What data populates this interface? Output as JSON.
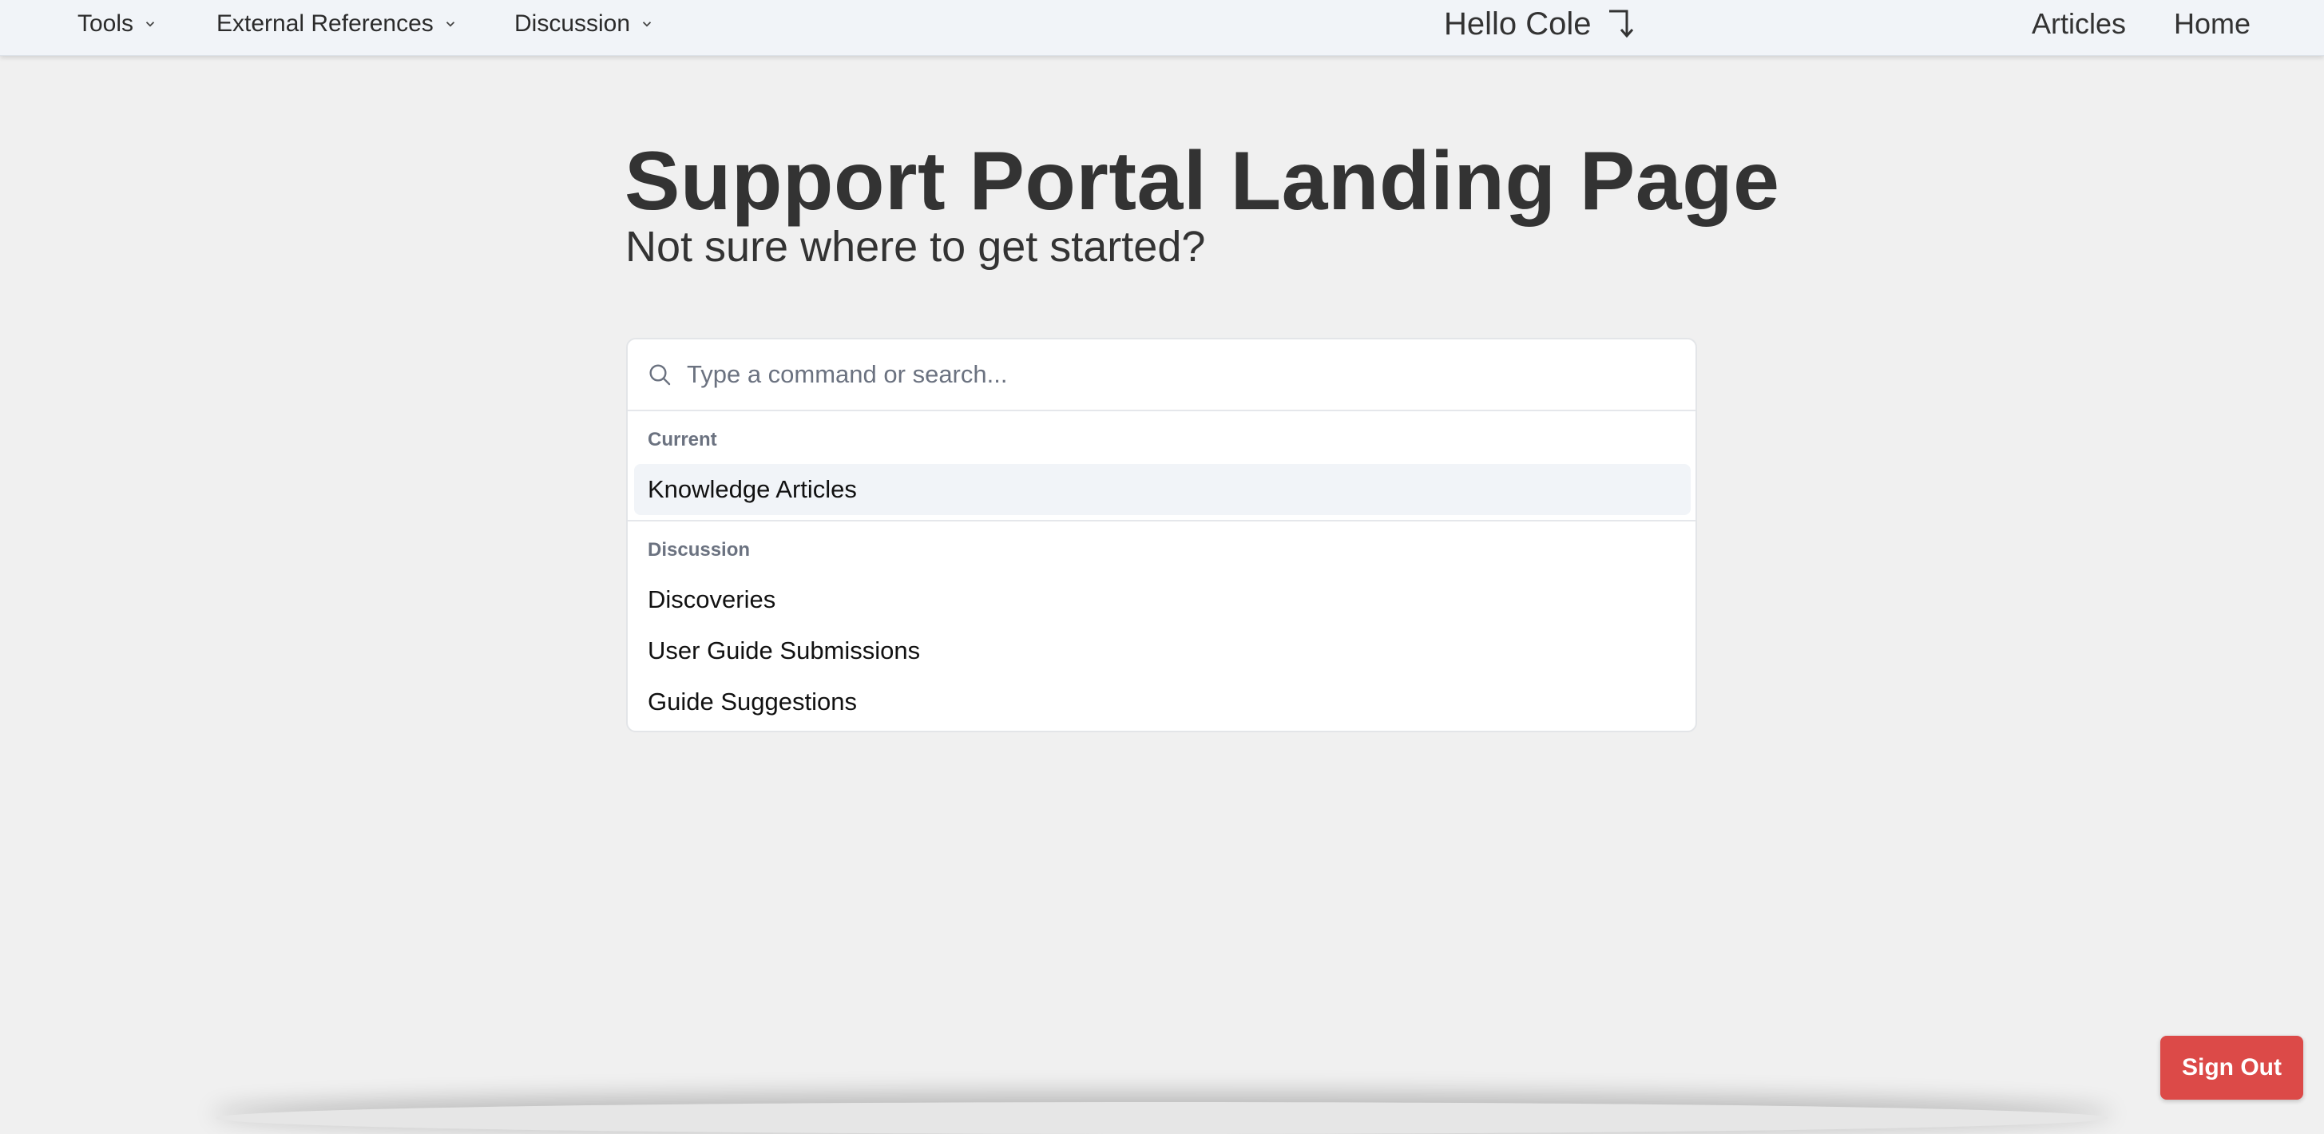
{
  "nav": {
    "menus": [
      {
        "label": "Tools"
      },
      {
        "label": "External References"
      },
      {
        "label": "Discussion"
      }
    ],
    "greeting": "Hello Cole",
    "links": [
      {
        "label": "Articles"
      },
      {
        "label": "Home"
      }
    ]
  },
  "hero": {
    "title": "Support Portal Landing Page",
    "subtitle": "Not sure where to get started?"
  },
  "command": {
    "placeholder": "Type a command or search...",
    "value": "",
    "groups": [
      {
        "heading": "Current",
        "items": [
          {
            "label": "Knowledge Articles",
            "selected": true
          }
        ]
      },
      {
        "heading": "Discussion",
        "items": [
          {
            "label": "Discoveries"
          },
          {
            "label": "User Guide Submissions"
          },
          {
            "label": "Guide Suggestions"
          }
        ]
      }
    ]
  },
  "footer": {
    "sign_out_label": "Sign Out"
  },
  "colors": {
    "danger": "#dc4a48",
    "topbar": "#f1f4f8",
    "background": "#f0f0f0"
  },
  "icons": {
    "menu_chevron": "chevron-down-icon",
    "greeting": "corner-down-arrow-icon",
    "search": "search-icon"
  }
}
